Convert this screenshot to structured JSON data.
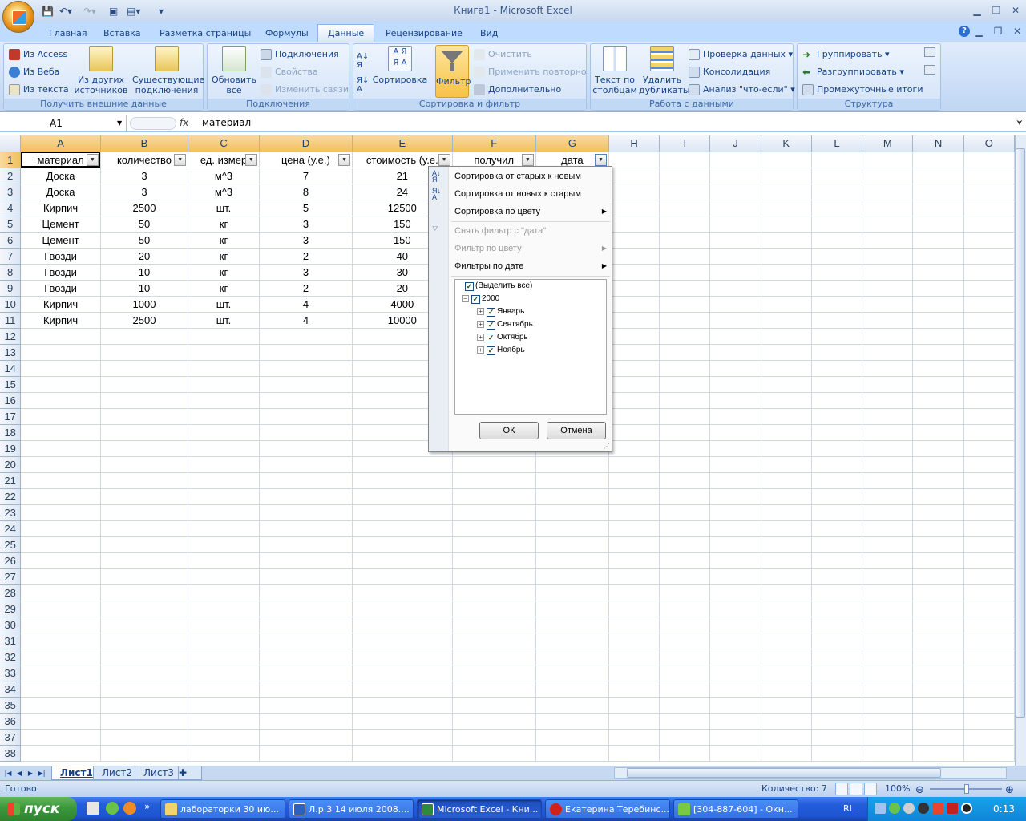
{
  "window": {
    "title": "Книга1 - Microsoft Excel"
  },
  "ribbon": {
    "tabs": [
      "Главная",
      "Вставка",
      "Разметка страницы",
      "Формулы",
      "Данные",
      "Рецензирование",
      "Вид"
    ],
    "active_tab": "Данные",
    "groups": {
      "external": {
        "label": "Получить внешние данные",
        "from_access": "Из Access",
        "from_web": "Из Веба",
        "from_text": "Из текста",
        "from_other": "Из других источников",
        "existing": "Существующие подключения"
      },
      "connections": {
        "label": "Подключения",
        "refresh_all": "Обновить все",
        "connections": "Подключения",
        "properties": "Свойства",
        "edit_links": "Изменить связи"
      },
      "sortfilter": {
        "label": "Сортировка и фильтр",
        "sort": "Сортировка",
        "filter": "Фильтр",
        "clear": "Очистить",
        "reapply": "Применить повторно",
        "advanced": "Дополнительно"
      },
      "datatools": {
        "label": "Работа с данными",
        "text_to_columns": "Текст по столбцам",
        "remove_dup": "Удалить дубликаты",
        "validation": "Проверка данных",
        "consolidate": "Консолидация",
        "whatif": "Анализ \"что-если\""
      },
      "outline": {
        "label": "Структура",
        "group": "Группировать",
        "ungroup": "Разгруппировать",
        "subtotal": "Промежуточные итоги"
      }
    }
  },
  "formula_bar": {
    "name_box": "A1",
    "fx": "fx",
    "value": "материал"
  },
  "sheet": {
    "columns": [
      "A",
      "B",
      "C",
      "D",
      "E",
      "F",
      "G",
      "H",
      "I",
      "J",
      "K",
      "L",
      "M",
      "N",
      "O"
    ],
    "headers": [
      "материал",
      "количество",
      "ед. измер",
      "цена (у.е.)",
      "стоимость (у.е.",
      "получил",
      "дата"
    ],
    "rows": [
      [
        "Доска",
        "3",
        "м^3",
        "7",
        "21"
      ],
      [
        "Доска",
        "3",
        "м^3",
        "8",
        "24"
      ],
      [
        "Кирпич",
        "2500",
        "шт.",
        "5",
        "12500"
      ],
      [
        "Цемент",
        "50",
        "кг",
        "3",
        "150"
      ],
      [
        "Цемент",
        "50",
        "кг",
        "3",
        "150"
      ],
      [
        "Гвозди",
        "20",
        "кг",
        "2",
        "40"
      ],
      [
        "Гвозди",
        "10",
        "кг",
        "3",
        "30"
      ],
      [
        "Гвозди",
        "10",
        "кг",
        "2",
        "20"
      ],
      [
        "Кирпич",
        "1000",
        "шт.",
        "4",
        "4000"
      ],
      [
        "Кирпич",
        "2500",
        "шт.",
        "4",
        "10000"
      ]
    ],
    "row_count": 38
  },
  "filter_menu": {
    "sort_old_new": "Сортировка от старых к новым",
    "sort_new_old": "Сортировка от новых к старым",
    "sort_by_color": "Сортировка по цвету",
    "clear_filter": "Снять фильтр с \"дата\"",
    "filter_by_color": "Фильтр по цвету",
    "date_filters": "Фильтры по дате",
    "select_all": "(Выделить все)",
    "year": "2000",
    "months": [
      "Январь",
      "Сентябрь",
      "Октябрь",
      "Ноябрь"
    ],
    "ok": "ОК",
    "cancel": "Отмена"
  },
  "sheet_tabs": [
    "Лист1",
    "Лист2",
    "Лист3"
  ],
  "status": {
    "ready": "Готово",
    "count": "Количество: 7",
    "zoom": "100%"
  },
  "taskbar": {
    "start": "пуск",
    "tasks": [
      "лабораторки 30 ию...",
      "Л.р.3 14 июля 2008....",
      "Microsoft Excel - Кни...",
      "Екатерина Теребинс...",
      "[304-887-604] - Окн..."
    ],
    "lang": "RL",
    "clock": "0:13"
  }
}
